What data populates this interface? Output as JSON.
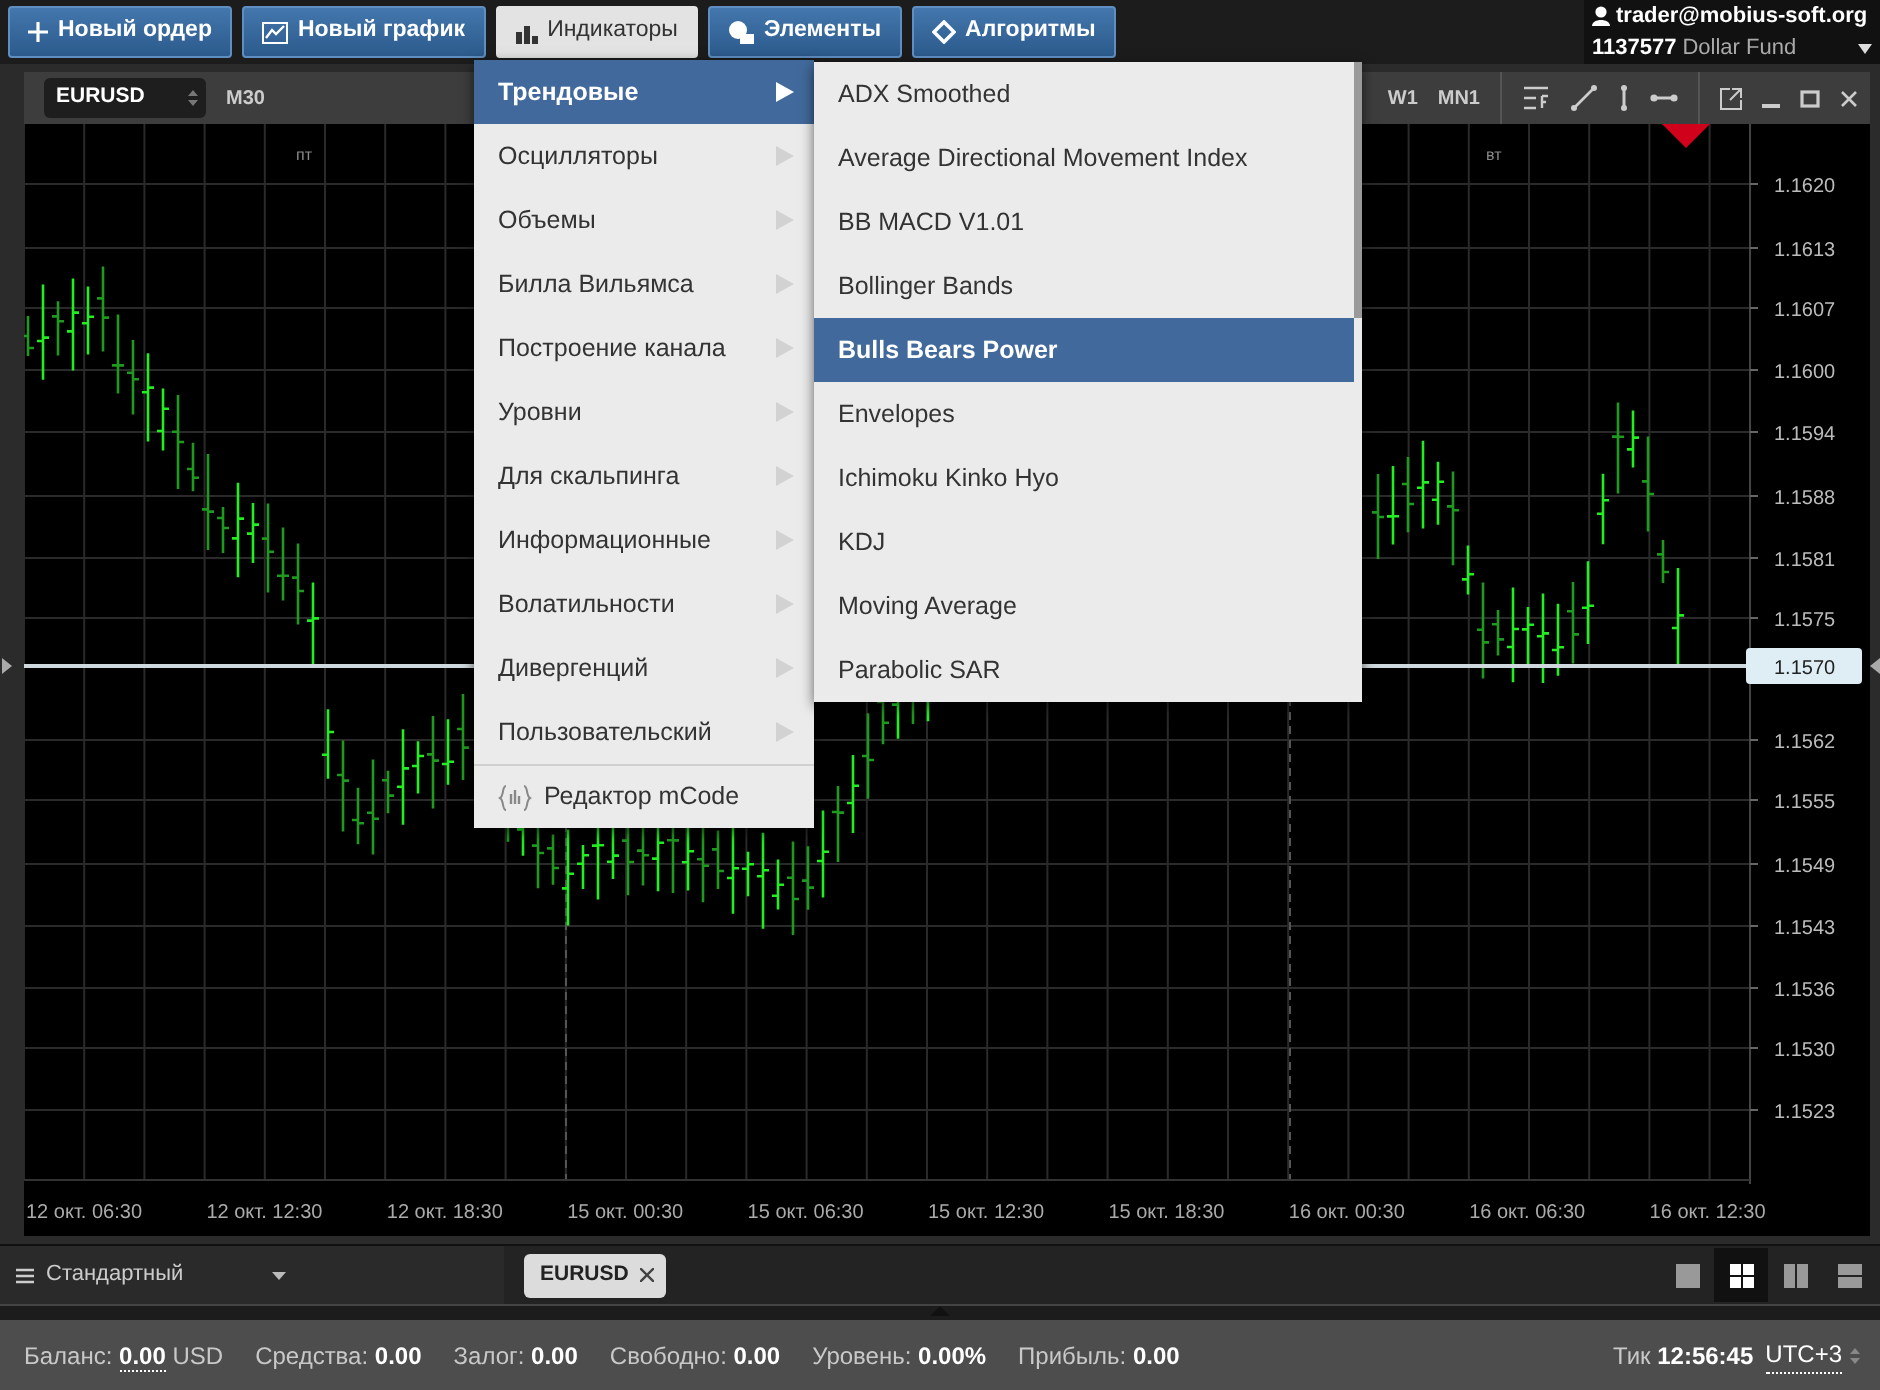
{
  "toolbar": {
    "buttons": [
      {
        "label": "Новый ордер",
        "selected": false
      },
      {
        "label": "Новый график",
        "selected": false
      },
      {
        "label": "Индикаторы",
        "selected": true
      },
      {
        "label": "Элементы",
        "selected": false
      },
      {
        "label": "Алгоритмы",
        "selected": false
      }
    ]
  },
  "account": {
    "user": "trader@mobius-soft.org",
    "number": "1137577",
    "fund": "Dollar Fund"
  },
  "chart_window": {
    "symbol": "EURUSD",
    "timeframe": "M30",
    "timeframes": [
      {
        "label": "W1"
      },
      {
        "label": "MN1"
      }
    ],
    "day_labels": [
      "пт",
      "вт"
    ],
    "price_labels": [
      "1.1620",
      "1.1613",
      "1.1607",
      "1.1600",
      "1.1594",
      "1.1588",
      "1.1581",
      "1.1575",
      "1.1562",
      "1.1555",
      "1.1549",
      "1.1543",
      "1.1536",
      "1.1530",
      "1.1523"
    ],
    "current_price": "1.1570",
    "time_labels": [
      "12 окт. 06:30",
      "12 окт. 12:30",
      "12 окт. 18:30",
      "15 окт. 00:30",
      "15 окт. 06:30",
      "15 окт. 12:30",
      "15 окт. 18:30",
      "16 окт. 00:30",
      "16 окт. 06:30",
      "16 окт. 12:30"
    ]
  },
  "indicator_menu": {
    "items": [
      {
        "label": "Трендовые",
        "kind": "submenu",
        "selected": true
      },
      {
        "label": "Осцилляторы",
        "kind": "submenu",
        "selected": false
      },
      {
        "label": "Объемы",
        "kind": "submenu",
        "selected": false
      },
      {
        "label": "Билла Вильямса",
        "kind": "submenu",
        "selected": false
      },
      {
        "label": "Построение канала",
        "kind": "submenu",
        "selected": false
      },
      {
        "label": "Уровни",
        "kind": "submenu",
        "selected": false
      },
      {
        "label": "Для скальпинга",
        "kind": "submenu",
        "selected": false
      },
      {
        "label": "Информационные",
        "kind": "submenu",
        "selected": false
      },
      {
        "label": "Волатильности",
        "kind": "submenu",
        "selected": false
      },
      {
        "label": "Дивергенций",
        "kind": "submenu",
        "selected": false
      },
      {
        "label": "Пользовательский",
        "kind": "submenu",
        "selected": false
      },
      {
        "label": "Редактор mCode",
        "kind": "command",
        "selected": false
      }
    ],
    "submenu": {
      "items": [
        {
          "label": "ADX Smoothed",
          "selected": false
        },
        {
          "label": "Average Directional Movement Index",
          "selected": false
        },
        {
          "label": "BB MACD V1.01",
          "selected": false
        },
        {
          "label": "Bollinger Bands",
          "selected": false
        },
        {
          "label": "Bulls Bears Power",
          "selected": true
        },
        {
          "label": "Envelopes",
          "selected": false
        },
        {
          "label": "Ichimoku Kinko Hyo",
          "selected": false
        },
        {
          "label": "KDJ",
          "selected": false
        },
        {
          "label": "Moving Average",
          "selected": false
        },
        {
          "label": "Parabolic SAR",
          "selected": false
        }
      ]
    }
  },
  "workspace": {
    "name": "Стандартный",
    "tabs": [
      {
        "label": "EURUSD",
        "selected": true
      }
    ],
    "layouts": [
      {
        "kind": "single",
        "selected": false
      },
      {
        "kind": "grid",
        "selected": true
      },
      {
        "kind": "columns",
        "selected": false
      },
      {
        "kind": "rows",
        "selected": false
      }
    ]
  },
  "status_bar": {
    "fields": [
      {
        "label": "Баланс:",
        "value": "0.00",
        "unit": "USD",
        "dotted": true
      },
      {
        "label": "Средства:",
        "value": "0.00",
        "dotted": false
      },
      {
        "label": "Залог:",
        "value": "0.00",
        "dotted": false
      },
      {
        "label": "Свободно:",
        "value": "0.00",
        "dotted": false
      },
      {
        "label": "Уровень:",
        "value": "0.00%",
        "dotted": false
      },
      {
        "label": "Прибыль:",
        "value": "0.00",
        "dotted": false
      }
    ],
    "tick_label": "Тик",
    "tick_time": "12:56:45",
    "timezone": "UTC+3"
  }
}
